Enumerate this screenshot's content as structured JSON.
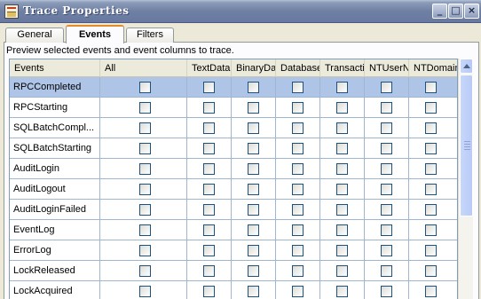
{
  "window": {
    "title": "Trace Properties",
    "buttons": {
      "minimize": "_",
      "maximize": "□",
      "close": "×"
    }
  },
  "tabs": [
    {
      "label": "General",
      "active": false
    },
    {
      "label": "Events",
      "active": true
    },
    {
      "label": "Filters",
      "active": false
    }
  ],
  "description": "Preview selected events and event columns to trace.",
  "grid": {
    "columns": [
      "Events",
      "All",
      "TextData",
      "BinaryData",
      "DatabaseID",
      "TransactionID",
      "NTUserName",
      "NTDomainName"
    ],
    "selected_row": 0,
    "rows": [
      {
        "event": "RPCCompleted"
      },
      {
        "event": "RPCStarting"
      },
      {
        "event": "SQLBatchCompl..."
      },
      {
        "event": "SQLBatchStarting"
      },
      {
        "event": "AuditLogin"
      },
      {
        "event": "AuditLogout"
      },
      {
        "event": "AuditLoginFailed"
      },
      {
        "event": "EventLog"
      },
      {
        "event": "ErrorLog"
      },
      {
        "event": "LockReleased"
      },
      {
        "event": "LockAcquired"
      }
    ]
  },
  "colors": {
    "selection": "#afc5e8",
    "title_bar": "#6f80a4",
    "active_tab_accent": "#e68b2c"
  }
}
